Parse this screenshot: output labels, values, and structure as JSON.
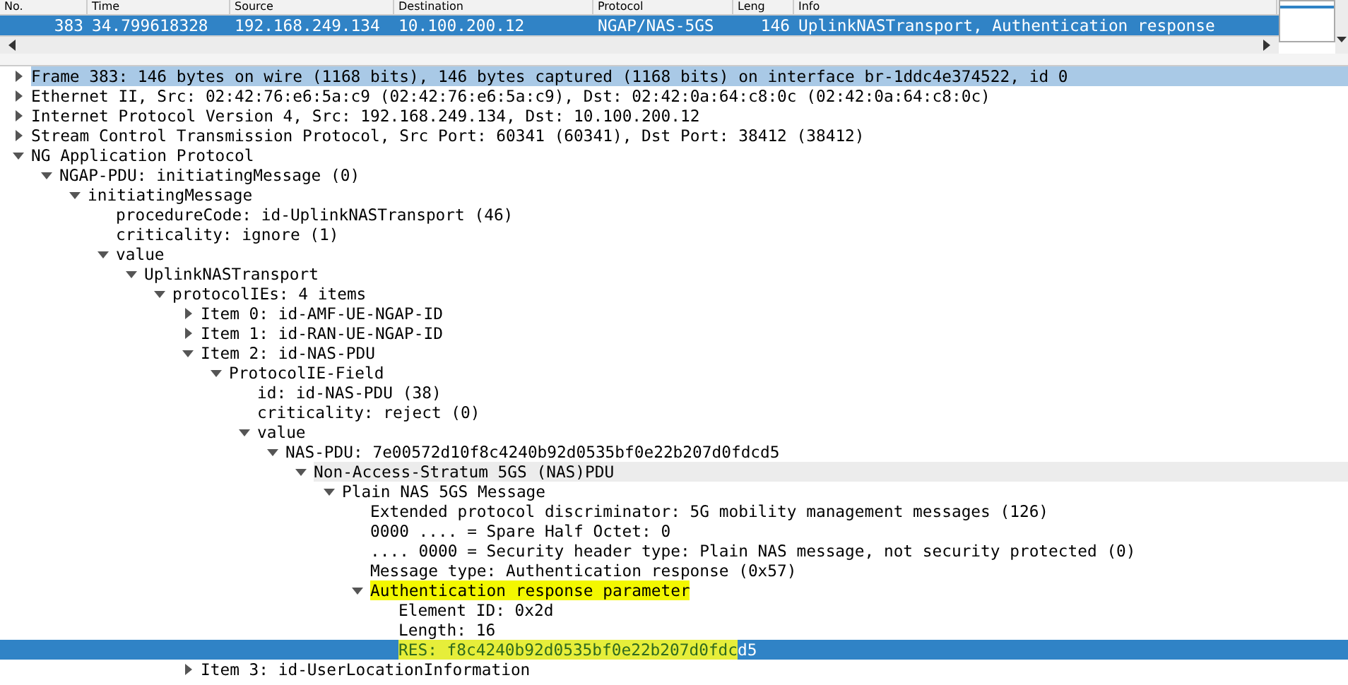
{
  "packet_list": {
    "columns": [
      "No.",
      "Time",
      "Source",
      "Destination",
      "Protocol",
      "Leng",
      "Info"
    ],
    "rows": [
      {
        "selected": true,
        "cells": [
          "383",
          "34.799618328",
          "192.168.249.134",
          "10.100.200.12",
          "NGAP/NAS-5GS",
          "146",
          "UplinkNASTransport, Authentication response"
        ]
      }
    ]
  },
  "details": {
    "tree": [
      {
        "text": "Frame 383: 146 bytes on wire (1168 bits), 146 bytes captured (1168 bits) on interface br-1ddc4e374522, id 0",
        "expanded": false,
        "selected": false,
        "marked": false,
        "emphasized": true,
        "hovered": false
      },
      {
        "text": "Ethernet II, Src: 02:42:76:e6:5a:c9 (02:42:76:e6:5a:c9), Dst: 02:42:0a:64:c8:0c (02:42:0a:64:c8:0c)",
        "expanded": false,
        "selected": false,
        "marked": false,
        "emphasized": false,
        "hovered": false
      },
      {
        "text": "Internet Protocol Version 4, Src: 192.168.249.134, Dst: 10.100.200.12",
        "expanded": false,
        "selected": false,
        "marked": false,
        "emphasized": false,
        "hovered": false
      },
      {
        "text": "Stream Control Transmission Protocol, Src Port: 60341 (60341), Dst Port: 38412 (38412)",
        "expanded": false,
        "selected": false,
        "marked": false,
        "emphasized": false,
        "hovered": false
      },
      {
        "text": "NG Application Protocol",
        "expanded": true,
        "selected": false,
        "marked": false,
        "emphasized": false,
        "hovered": false,
        "children": [
          {
            "text": "NGAP-PDU: initiatingMessage (0)",
            "expanded": true,
            "selected": false,
            "marked": false,
            "emphasized": false,
            "hovered": false,
            "children": [
              {
                "text": "initiatingMessage",
                "expanded": true,
                "selected": false,
                "marked": false,
                "emphasized": false,
                "hovered": false,
                "children": [
                  {
                    "text": "procedureCode: id-UplinkNASTransport (46)",
                    "selected": false,
                    "marked": false,
                    "emphasized": false,
                    "hovered": false
                  },
                  {
                    "text": "criticality: ignore (1)",
                    "selected": false,
                    "marked": false,
                    "emphasized": false,
                    "hovered": false
                  },
                  {
                    "text": "value",
                    "expanded": true,
                    "selected": false,
                    "marked": false,
                    "emphasized": false,
                    "hovered": false,
                    "children": [
                      {
                        "text": "UplinkNASTransport",
                        "expanded": true,
                        "selected": false,
                        "marked": false,
                        "emphasized": false,
                        "hovered": false,
                        "children": [
                          {
                            "text": "protocolIEs: 4 items",
                            "expanded": true,
                            "selected": false,
                            "marked": false,
                            "emphasized": false,
                            "hovered": false,
                            "children": [
                              {
                                "text": "Item 0: id-AMF-UE-NGAP-ID",
                                "expanded": false,
                                "selected": false,
                                "marked": false,
                                "emphasized": false,
                                "hovered": false
                              },
                              {
                                "text": "Item 1: id-RAN-UE-NGAP-ID",
                                "expanded": false,
                                "selected": false,
                                "marked": false,
                                "emphasized": false,
                                "hovered": false
                              },
                              {
                                "text": "Item 2: id-NAS-PDU",
                                "expanded": true,
                                "selected": false,
                                "marked": false,
                                "emphasized": false,
                                "hovered": false,
                                "children": [
                                  {
                                    "text": "ProtocolIE-Field",
                                    "expanded": true,
                                    "selected": false,
                                    "marked": false,
                                    "emphasized": false,
                                    "hovered": false,
                                    "children": [
                                      {
                                        "text": "id: id-NAS-PDU (38)",
                                        "selected": false,
                                        "marked": false,
                                        "emphasized": false,
                                        "hovered": false
                                      },
                                      {
                                        "text": "criticality: reject (0)",
                                        "selected": false,
                                        "marked": false,
                                        "emphasized": false,
                                        "hovered": false
                                      },
                                      {
                                        "text": "value",
                                        "expanded": true,
                                        "selected": false,
                                        "marked": false,
                                        "emphasized": false,
                                        "hovered": false,
                                        "children": [
                                          {
                                            "text": "NAS-PDU: 7e00572d10f8c4240b92d0535bf0e22b207d0fdcd5",
                                            "expanded": true,
                                            "selected": false,
                                            "marked": false,
                                            "emphasized": false,
                                            "hovered": false,
                                            "children": [
                                              {
                                                "text": "Non-Access-Stratum 5GS (NAS)PDU",
                                                "expanded": true,
                                                "selected": false,
                                                "marked": false,
                                                "emphasized": false,
                                                "hovered": true,
                                                "children": [
                                                  {
                                                    "text": "Plain NAS 5GS Message",
                                                    "expanded": true,
                                                    "selected": false,
                                                    "marked": false,
                                                    "emphasized": false,
                                                    "hovered": false,
                                                    "children": [
                                                      {
                                                        "text": "Extended protocol discriminator: 5G mobility management messages (126)",
                                                        "selected": false,
                                                        "marked": false,
                                                        "emphasized": false,
                                                        "hovered": false
                                                      },
                                                      {
                                                        "text": "0000 .... = Spare Half Octet: 0",
                                                        "selected": false,
                                                        "marked": false,
                                                        "emphasized": false,
                                                        "hovered": false
                                                      },
                                                      {
                                                        "text": ".... 0000 = Security header type: Plain NAS message, not security protected (0)",
                                                        "selected": false,
                                                        "marked": false,
                                                        "emphasized": false,
                                                        "hovered": false
                                                      },
                                                      {
                                                        "text": "Message type: Authentication response (0x57)",
                                                        "selected": false,
                                                        "marked": false,
                                                        "emphasized": false,
                                                        "hovered": false
                                                      },
                                                      {
                                                        "text": "Authentication response parameter",
                                                        "expanded": true,
                                                        "selected": false,
                                                        "marked": true,
                                                        "emphasized": false,
                                                        "hovered": false,
                                                        "children": [
                                                          {
                                                            "text": "Element ID: 0x2d",
                                                            "selected": false,
                                                            "marked": false,
                                                            "emphasized": false,
                                                            "hovered": false
                                                          },
                                                          {
                                                            "text": "Length: 16",
                                                            "selected": false,
                                                            "marked": false,
                                                            "emphasized": false,
                                                            "hovered": false
                                                          },
                                                          {
                                                            "text": "RES: f8c4240b92d0535bf0e22b207d0fdc",
                                                            "rest": "d5",
                                                            "selected": true,
                                                            "marked": true,
                                                            "emphasized": false,
                                                            "hovered": false
                                                          }
                                                        ]
                                                      }
                                                    ]
                                                  }
                                                ]
                                              }
                                            ]
                                          }
                                        ]
                                      }
                                    ]
                                  }
                                ]
                              },
                              {
                                "text": "Item 3: id-UserLocationInformation",
                                "expanded": false,
                                "selected": false,
                                "marked": false,
                                "emphasized": false,
                                "hovered": false
                              }
                            ]
                          }
                        ]
                      }
                    ]
                  }
                ]
              }
            ]
          }
        ]
      }
    ]
  }
}
